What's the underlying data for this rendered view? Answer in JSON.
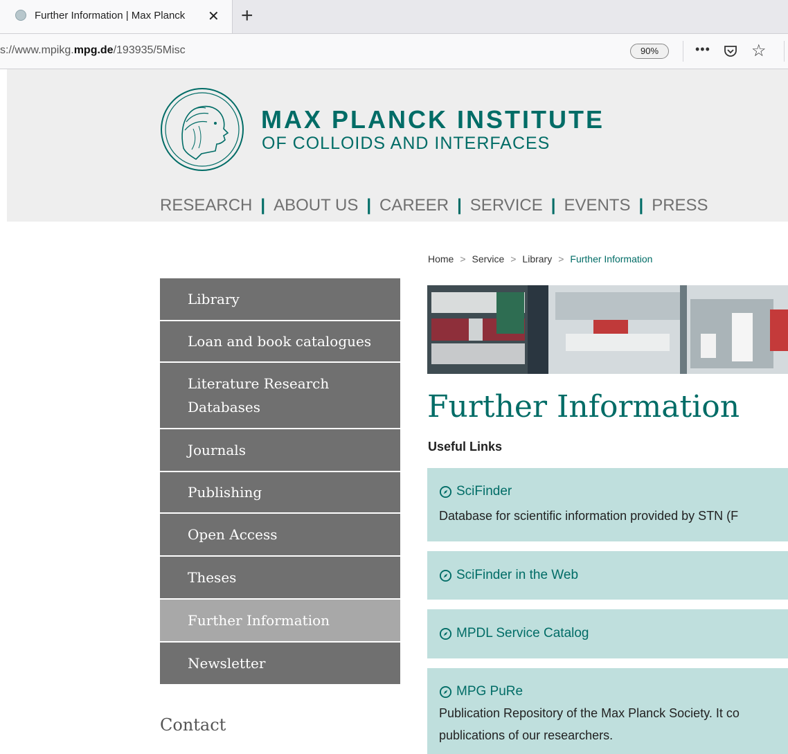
{
  "browser": {
    "tab_title": "Further Information | Max Planck",
    "url_prefix": "s://www.mpikg.",
    "url_domain": "mpg.de",
    "url_path": "/193935/5Misc",
    "zoom": "90%",
    "more_glyph": "•••",
    "star_glyph": "☆",
    "close_glyph": "✕",
    "newtab_glyph": "+"
  },
  "header": {
    "brand_line1": "MAX PLANCK INSTITUTE",
    "brand_line2": "OF COLLOIDS AND INTERFACES",
    "brand_color": "#006c66"
  },
  "nav": {
    "separator": "|",
    "items": [
      "RESEARCH",
      "ABOUT US",
      "CAREER",
      "SERVICE",
      "EVENTS",
      "PRESS"
    ]
  },
  "breadcrumb": {
    "separator": ">",
    "items": [
      "Home",
      "Service",
      "Library"
    ],
    "current": "Further Information"
  },
  "sidebar": {
    "items": [
      {
        "label": "Library"
      },
      {
        "label": "Loan and book catalogues"
      },
      {
        "label": "Literature Research Databases"
      },
      {
        "label": "Journals"
      },
      {
        "label": "Publishing"
      },
      {
        "label": "Open Access"
      },
      {
        "label": "Theses"
      },
      {
        "label": "Further Information",
        "active": true
      },
      {
        "label": "Newsletter"
      }
    ],
    "contact_heading": "Contact"
  },
  "main": {
    "title": "Further Information",
    "subheading": "Useful Links",
    "links": [
      {
        "label": "SciFinder",
        "description": "Database for scientific information provided by STN (F"
      },
      {
        "label": "SciFinder in the Web"
      },
      {
        "label": "MPDL Service Catalog"
      },
      {
        "label": "MPG PuRe",
        "description": "Publication Repository of the Max Planck Society. It co",
        "description2": "publications of our researchers."
      }
    ]
  }
}
